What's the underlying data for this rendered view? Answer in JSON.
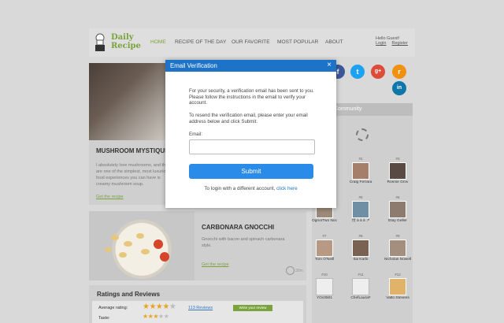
{
  "logo": {
    "line1": "Daily",
    "line2": "Recipe"
  },
  "nav": {
    "items": [
      "HOME",
      "RECIPE OF THE DAY",
      "OUR FAVORITE",
      "MOST POPULAR",
      "ABOUT"
    ],
    "active": "HOME"
  },
  "user": {
    "greeting": "Hello Guest!",
    "login": "Login",
    "register": "Register"
  },
  "hero": {
    "title": "MUSHROOM MYSTIQUE",
    "description": "I absolutely love mushrooms, and they are one of the simplest, most luxurious food experiences you can have is creamy mushroom soup.",
    "link": "Get the recipe"
  },
  "card2": {
    "title": "CARBONARA GNOCCHI",
    "description": "Gnocchi with bacon and spinach carbonara style.",
    "link": "Get the recipe",
    "time": "30m"
  },
  "ratings": {
    "title": "Ratings and Reviews",
    "average_label": "Average rating:",
    "average_stars": 4,
    "reviews_link": "113 Reviews",
    "write_review": "Write your review",
    "taste_label": "Taste:",
    "taste_stars": 3.5
  },
  "social": {
    "icons": [
      "facebook-icon",
      "twitter-icon",
      "google-plus-icon",
      "rss-icon",
      "linkedin-icon"
    ],
    "glyphs": [
      "f",
      "t",
      "g+",
      "r",
      "in"
    ]
  },
  "community": {
    "title": "Community",
    "members": [
      {
        "rank": "#2",
        "name": "Craig Ferrara"
      },
      {
        "rank": "#3",
        "name": "Ronnie Grov"
      },
      {
        "rank": "#4",
        "name": "OgnorTwo Noc"
      },
      {
        "rank": "#5",
        "name": "付 à à à ↗"
      },
      {
        "rank": "#6",
        "name": "Etay Geller"
      },
      {
        "rank": "#7",
        "name": "Tom O'Neill"
      },
      {
        "rank": "#8",
        "name": "Itai Karbi"
      },
      {
        "rank": "#9",
        "name": "Nicholas Nowell"
      },
      {
        "rank": "#10",
        "name": "YOc0501"
      },
      {
        "rank": "#11",
        "name": "ChefLauraF"
      },
      {
        "rank": "#12",
        "name": "Vatto Stevens"
      }
    ]
  },
  "modal": {
    "title": "Email Verification",
    "close": "×",
    "para1": "For your security, a verification email has been sent to you. Please follow the instructions in the email to verify your account.",
    "para2": "To resend the verification email, please enter your email address below and click Submit.",
    "email_label": "Email:",
    "email_value": "",
    "submit": "Submit",
    "login_text": "To login with a different account,",
    "login_link": "click here"
  },
  "colors": {
    "accent_green": "#7aa33c",
    "modal_blue": "#1c73c8",
    "button_blue": "#2b8be8"
  }
}
